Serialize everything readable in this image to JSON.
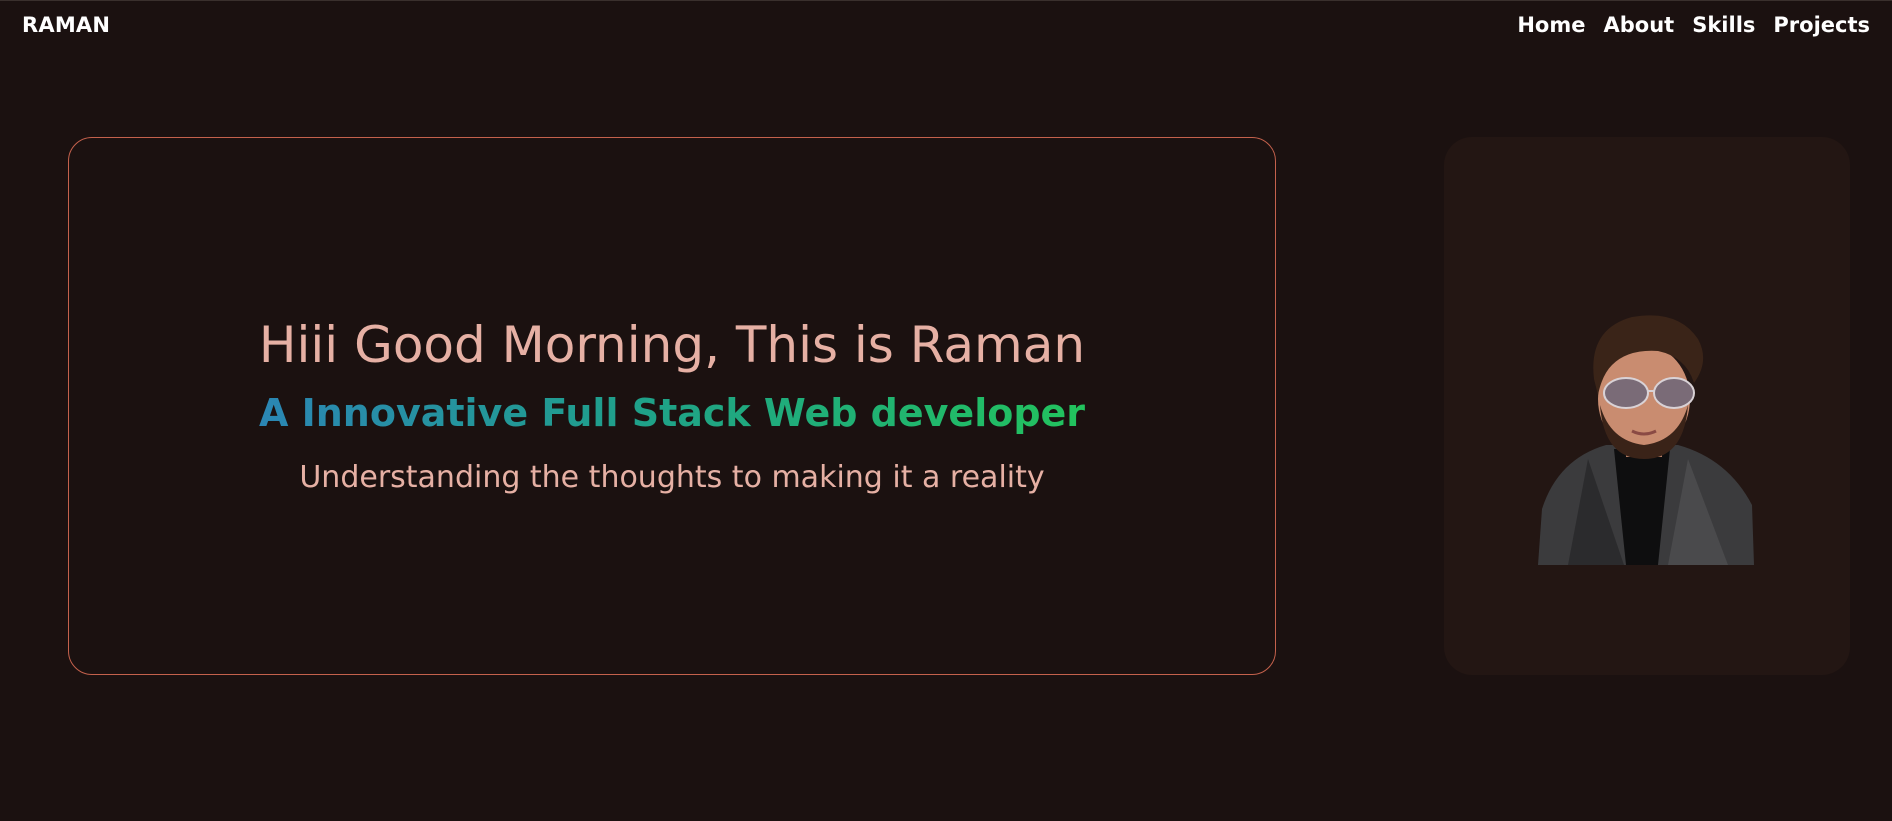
{
  "nav": {
    "brand": "RAMAN",
    "links": [
      {
        "label": "Home"
      },
      {
        "label": "About"
      },
      {
        "label": "Skills"
      },
      {
        "label": "Projects"
      }
    ]
  },
  "hero": {
    "greeting": "Hiii Good Morning, This is Raman",
    "tagline": "A Innovative Full Stack Web developer",
    "motto": "Understanding the thoughts to making it a reality"
  },
  "colors": {
    "background": "#1b1110",
    "card_border": "#c4614c",
    "greeting_text": "#e6b0a4",
    "tagline_gradient_start": "#2b86b4",
    "tagline_gradient_end": "#22c35d",
    "photo_card_bg": "#231613"
  }
}
